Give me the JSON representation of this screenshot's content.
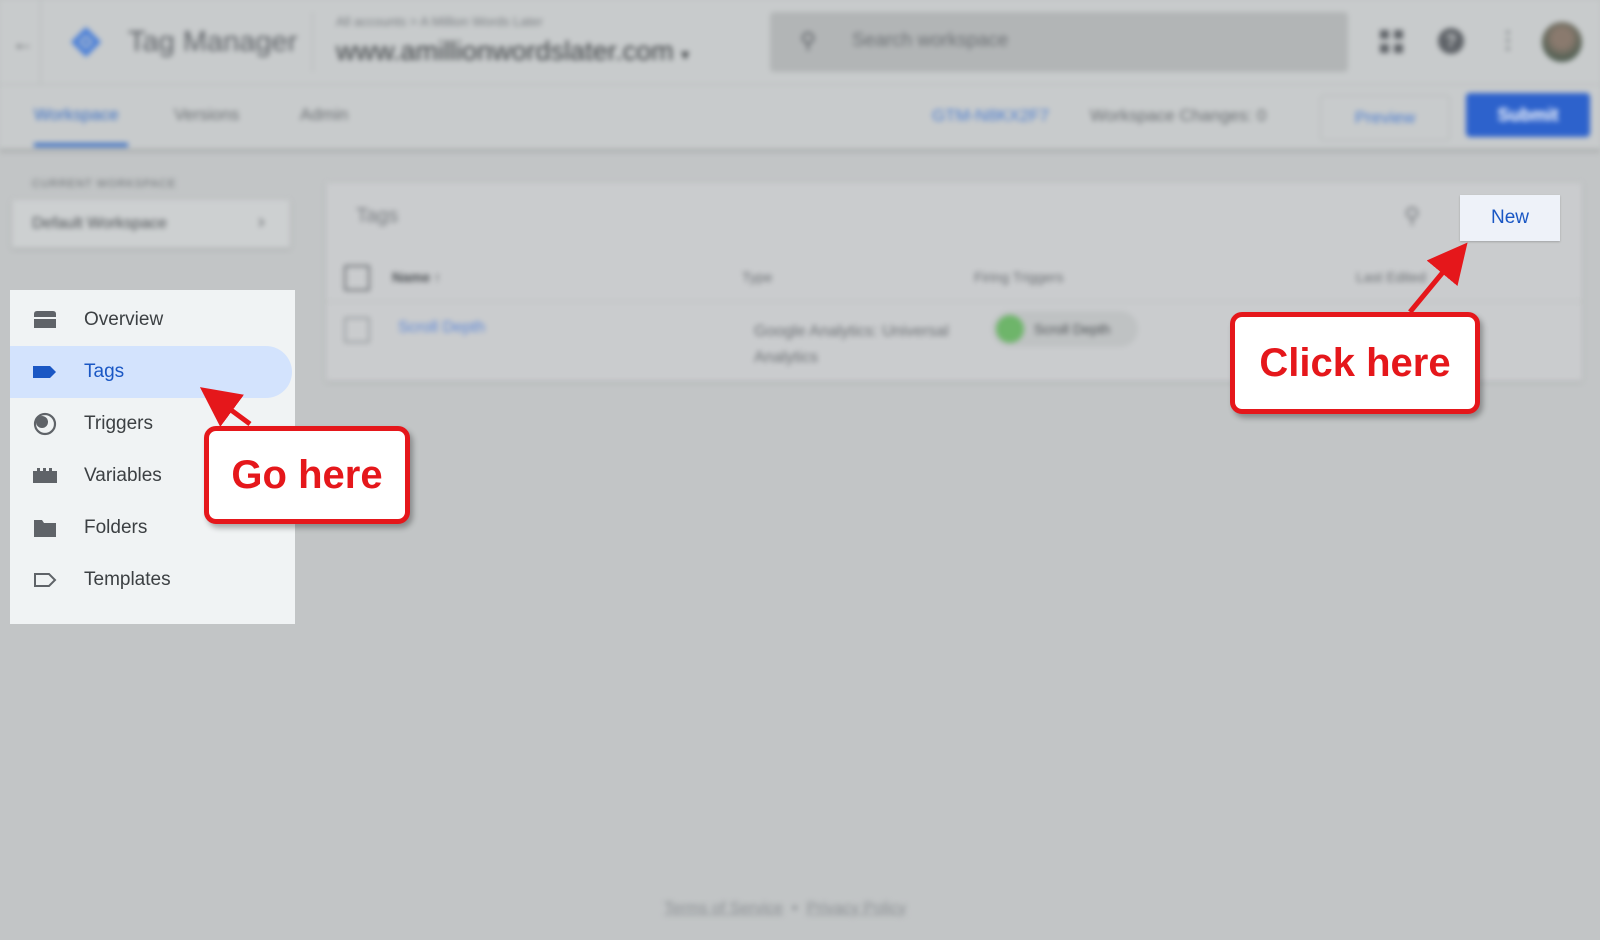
{
  "appbar": {
    "product": "Tag Manager",
    "breadcrumb": "All accounts > A Million Words Later",
    "container": "www.amillionwordslater.com",
    "search_placeholder": "Search workspace"
  },
  "tabs": {
    "workspace": "Workspace",
    "versions": "Versions",
    "admin": "Admin",
    "container_id": "GTM-N8KX2F7",
    "workspace_changes": "Workspace Changes: 0",
    "preview": "Preview",
    "submit": "Submit"
  },
  "workspace": {
    "label": "CURRENT WORKSPACE",
    "name": "Default Workspace"
  },
  "nav": {
    "items": [
      {
        "label": "Overview"
      },
      {
        "label": "Tags"
      },
      {
        "label": "Triggers"
      },
      {
        "label": "Variables"
      },
      {
        "label": "Folders"
      },
      {
        "label": "Templates"
      }
    ]
  },
  "tags_panel": {
    "title": "Tags",
    "new_button": "New",
    "columns": [
      "Name",
      "Type",
      "Firing Triggers",
      "Last Edited"
    ],
    "rows": [
      {
        "name": "Scroll Depth",
        "type": "Google Analytics: Universal Analytics",
        "trigger": "Scroll Depth"
      }
    ]
  },
  "footer": {
    "terms": "Terms of Service",
    "separator": "•",
    "privacy": "Privacy Policy"
  },
  "callouts": {
    "go_here": "Go here",
    "click_here": "Click here"
  },
  "colors": {
    "callout_red": "#e5171b",
    "primary_blue": "#1a57c4",
    "active_nav_bg": "#d3e3fd"
  }
}
